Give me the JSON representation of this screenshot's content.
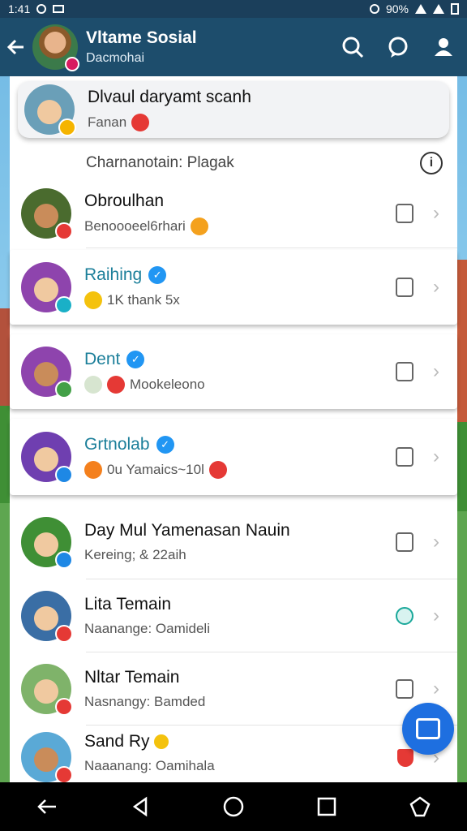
{
  "status_bar": {
    "time": "1:41",
    "battery": "90%"
  },
  "header": {
    "title": "Vltame Sosial",
    "subtitle": "Dacmohai"
  },
  "pinned": {
    "name": "Dlvaul daryamt scanh",
    "sub": "Fanan"
  },
  "section": {
    "title": "Charnanotain: Plagak"
  },
  "rows": [
    {
      "name": "Obroulhan",
      "sub": "Benoooeel6rhari",
      "teal": false
    },
    {
      "name": "Raihing",
      "sub": "1K thank 5x",
      "teal": true
    },
    {
      "name": "Dent",
      "sub": "Mookeleono",
      "teal": true
    },
    {
      "name": "Grtnolab",
      "sub": "0u Yamaics~10l",
      "teal": true
    },
    {
      "name": "Day Mul Yamenasan Nauin",
      "sub": "Kereing; & 22aih",
      "teal": false
    },
    {
      "name": "Lita Temain",
      "sub": "Naanange: Oamideli",
      "teal": false
    },
    {
      "name": "Nltar Temain",
      "sub": "Nasnangy: Bamded",
      "teal": false
    },
    {
      "name": "Sand Ry",
      "sub": "Naaanang: Oamihala",
      "teal": false
    }
  ],
  "colors": {
    "appbar": "#1d4d6c",
    "accent": "#1e6fe0",
    "teal_text": "#1c7f9a"
  },
  "icons": {
    "back": "arrow-left-icon",
    "search": "search-icon",
    "chat": "chat-bubble-icon",
    "profile": "person-icon",
    "info": "info-icon",
    "fab": "compose-icon"
  }
}
